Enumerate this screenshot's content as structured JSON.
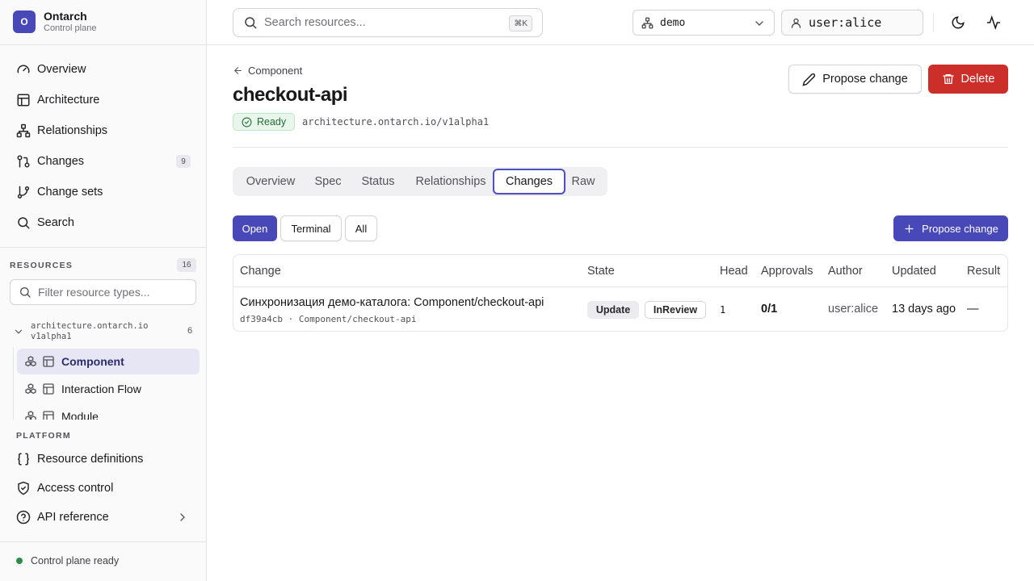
{
  "brand": {
    "logo_letter": "O",
    "name": "Ontarch",
    "subtitle": "Control plane"
  },
  "nav": {
    "overview": "Overview",
    "architecture": "Architecture",
    "relationships": "Relationships",
    "changes": "Changes",
    "changes_count": "9",
    "change_sets": "Change sets",
    "search": "Search"
  },
  "resources": {
    "section_label": "RESOURCES",
    "count": "16",
    "filter_placeholder": "Filter resource types...",
    "group": {
      "name": "architecture.ontarch.io",
      "version": "v1alpha1",
      "count": "6"
    },
    "items": [
      "Component",
      "Interaction Flow",
      "Module"
    ],
    "active_item": "Component"
  },
  "platform": {
    "section_label": "PLATFORM",
    "resource_definitions": "Resource definitions",
    "access_control": "Access control",
    "api_reference": "API reference"
  },
  "status": {
    "text": "Control plane ready",
    "color": "#2e8b4a"
  },
  "topbar": {
    "search_placeholder": "Search resources...",
    "search_shortcut": "⌘K",
    "namespace": "demo",
    "user": "user:alice"
  },
  "page": {
    "back_label": "Component",
    "title": "checkout-api",
    "status_badge": "Ready",
    "api_version": "architecture.ontarch.io/v1alpha1",
    "propose_change": "Propose change",
    "delete": "Delete"
  },
  "tabs": [
    "Overview",
    "Spec",
    "Status",
    "Relationships",
    "Changes",
    "Raw"
  ],
  "active_tab": "Changes",
  "filters": {
    "open": "Open",
    "terminal": "Terminal",
    "all": "All",
    "active": "Open"
  },
  "propose_change_button": "Propose change",
  "table": {
    "columns": [
      "Change",
      "State",
      "Head",
      "Approvals",
      "Author",
      "Updated",
      "Result"
    ],
    "rows": [
      {
        "title": "Синхронизация демо-каталога: Component/checkout-api",
        "subtitle": "df39a4cb · Component/checkout-api",
        "state_type": "Update",
        "state_phase": "InReview",
        "head": "1",
        "approvals": "0/1",
        "author": "user:alice",
        "updated": "13 days ago",
        "result": "—"
      }
    ]
  },
  "colors": {
    "accent": "#4848b8",
    "danger": "#cc2f2a",
    "ready_bg": "#e9f6ec",
    "ready_text": "#216e38"
  }
}
